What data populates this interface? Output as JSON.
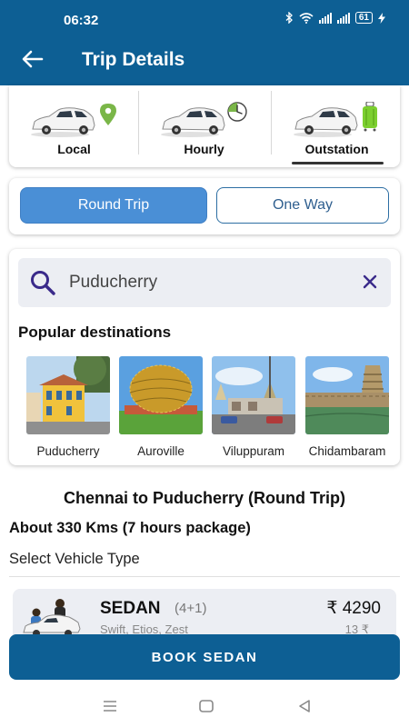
{
  "status_bar": {
    "time": "06:32",
    "battery": "61",
    "icons": [
      "bluetooth-icon",
      "wifi-icon",
      "signal-icon",
      "signal-icon",
      "charging-icon"
    ]
  },
  "header": {
    "title": "Trip Details",
    "back_icon": "arrow-left-icon"
  },
  "categories": {
    "items": [
      {
        "label": "Local",
        "icon": "location-pin-icon",
        "badge_color": "#7ab648"
      },
      {
        "label": "Hourly",
        "icon": "clock-icon",
        "badge_color": "#7ab648"
      },
      {
        "label": "Outstation",
        "icon": "luggage-icon",
        "badge_color": "#7ccf2f"
      }
    ],
    "selected": "Outstation"
  },
  "trip_type": {
    "options": [
      "Round Trip",
      "One Way"
    ],
    "selected": "Round Trip"
  },
  "search": {
    "value": "Puducherry",
    "icon": "search-icon",
    "clear_icon": "close-icon"
  },
  "popular": {
    "title": "Popular destinations",
    "items": [
      {
        "name": "Puducherry"
      },
      {
        "name": "Auroville"
      },
      {
        "name": "Viluppuram"
      },
      {
        "name": "Chidambaram"
      }
    ]
  },
  "route": {
    "title": "Chennai to Puducherry (Round Trip)",
    "about": "About 330 Kms (7 hours package)",
    "select_label": "Select Vehicle Type"
  },
  "vehicle": {
    "name": "SEDAN",
    "capacity": "(4+1)",
    "price": "₹ 4290",
    "subtitle": "Swift, Etios, Zest",
    "subtitle_right": "13 ₹"
  },
  "book_button": "BOOK SEDAN",
  "nav": [
    "menu-icon",
    "home-square-icon",
    "back-triangle-icon"
  ],
  "colors": {
    "primary": "#0d5f94",
    "accent": "#4a8fd6",
    "search_bg": "#eceef3"
  }
}
